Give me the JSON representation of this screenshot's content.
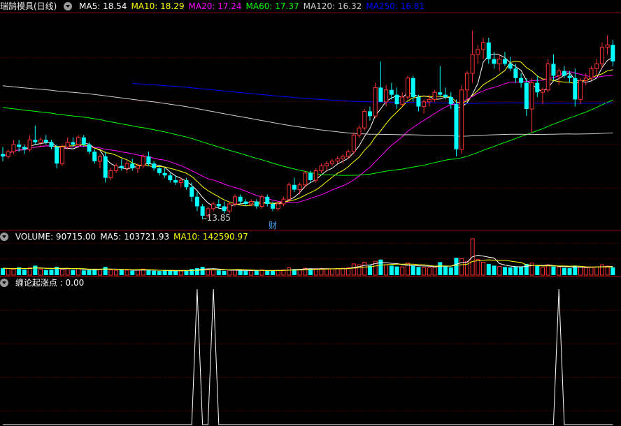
{
  "panels": {
    "price": {
      "title": "瑞鹄模具(日线)",
      "indicators": [
        {
          "label": "MA5: 18.54",
          "color": "#ffffff"
        },
        {
          "label": "MA10: 18.29",
          "color": "#ffff00"
        },
        {
          "label": "MA20: 17.24",
          "color": "#ff00ff"
        },
        {
          "label": "MA60: 17.37",
          "color": "#00ff00"
        },
        {
          "label": "MA120: 16.32",
          "color": "#d0d0d0"
        },
        {
          "label": "MA250: 16.81",
          "color": "#0000ff"
        }
      ],
      "low_marker": "13.85",
      "event_marker": "财"
    },
    "volume": {
      "indicators": [
        {
          "label": "VOLUME: 90715.00",
          "color": "#ffffff"
        },
        {
          "label": "MA5: 103721.93",
          "color": "#ffffff"
        },
        {
          "label": "MA10: 142590.97",
          "color": "#ffff00"
        }
      ]
    },
    "signal": {
      "indicators": [
        {
          "label": "缠论起涨点 : 0.00",
          "color": "#ffffff"
        }
      ]
    }
  },
  "colors": {
    "up": "#ff3232",
    "down": "#00ffff",
    "grid": "#7a0000"
  },
  "chart_data": [
    {
      "type": "candlestick",
      "title": "瑞鹄模具(日线)",
      "ylim": [
        13.5,
        22.5
      ],
      "candles": [
        [
          16.6,
          16.9,
          16.3,
          16.5
        ],
        [
          16.5,
          16.8,
          16.4,
          16.7
        ],
        [
          16.7,
          17.2,
          16.6,
          17.0
        ],
        [
          17.0,
          17.2,
          16.7,
          16.9
        ],
        [
          16.9,
          17.0,
          16.6,
          16.8
        ],
        [
          16.8,
          17.4,
          16.7,
          17.2
        ],
        [
          17.2,
          17.8,
          17.0,
          17.1
        ],
        [
          17.1,
          17.3,
          16.9,
          17.2
        ],
        [
          17.2,
          17.4,
          17.0,
          17.1
        ],
        [
          17.1,
          17.2,
          16.8,
          16.9
        ],
        [
          16.9,
          17.0,
          16.0,
          16.2
        ],
        [
          16.2,
          17.0,
          16.1,
          16.9
        ],
        [
          16.9,
          17.3,
          16.8,
          17.1
        ],
        [
          17.1,
          17.3,
          16.9,
          17.0
        ],
        [
          17.0,
          17.4,
          16.9,
          17.3
        ],
        [
          17.3,
          17.4,
          16.9,
          17.0
        ],
        [
          17.0,
          17.1,
          16.6,
          16.7
        ],
        [
          16.7,
          16.8,
          16.2,
          16.3
        ],
        [
          16.3,
          16.6,
          16.0,
          16.5
        ],
        [
          16.5,
          16.7,
          15.4,
          15.6
        ],
        [
          15.6,
          16.0,
          15.5,
          15.9
        ],
        [
          15.9,
          16.2,
          15.8,
          16.1
        ],
        [
          16.1,
          16.4,
          15.9,
          16.0
        ],
        [
          16.0,
          16.3,
          15.8,
          16.2
        ],
        [
          16.2,
          16.4,
          15.9,
          16.0
        ],
        [
          16.0,
          16.2,
          15.8,
          16.1
        ],
        [
          16.1,
          16.6,
          16.0,
          16.5
        ],
        [
          16.5,
          16.7,
          16.1,
          16.2
        ],
        [
          16.2,
          16.3,
          15.9,
          16.0
        ],
        [
          16.0,
          16.1,
          15.7,
          15.8
        ],
        [
          15.8,
          16.0,
          15.6,
          15.7
        ],
        [
          15.7,
          15.8,
          15.4,
          15.5
        ],
        [
          15.5,
          15.7,
          15.3,
          15.4
        ],
        [
          15.4,
          15.6,
          15.2,
          15.5
        ],
        [
          15.5,
          15.6,
          15.1,
          15.2
        ],
        [
          15.2,
          15.4,
          14.6,
          14.8
        ],
        [
          14.8,
          15.0,
          14.2,
          14.4
        ],
        [
          14.4,
          14.5,
          13.85,
          14.0
        ],
        [
          14.0,
          14.4,
          13.9,
          14.3
        ],
        [
          14.3,
          14.6,
          14.2,
          14.5
        ],
        [
          14.5,
          14.7,
          14.3,
          14.4
        ],
        [
          14.4,
          14.6,
          14.1,
          14.2
        ],
        [
          14.2,
          14.6,
          14.1,
          14.5
        ],
        [
          14.5,
          14.9,
          14.4,
          14.8
        ],
        [
          14.8,
          14.9,
          14.5,
          14.6
        ],
        [
          14.6,
          14.7,
          14.4,
          14.5
        ],
        [
          14.5,
          14.7,
          14.4,
          14.6
        ],
        [
          14.6,
          14.7,
          14.3,
          14.4
        ],
        [
          14.4,
          14.9,
          14.3,
          14.8
        ],
        [
          14.8,
          14.9,
          14.4,
          14.5
        ],
        [
          14.5,
          14.6,
          14.2,
          14.3
        ],
        [
          14.3,
          14.6,
          14.2,
          14.5
        ],
        [
          14.5,
          14.8,
          14.4,
          14.7
        ],
        [
          14.7,
          15.4,
          14.6,
          15.3
        ],
        [
          15.3,
          15.6,
          15.0,
          15.1
        ],
        [
          15.1,
          15.4,
          14.9,
          15.3
        ],
        [
          15.3,
          15.9,
          15.2,
          15.8
        ],
        [
          15.8,
          15.9,
          15.4,
          15.5
        ],
        [
          15.5,
          16.0,
          15.4,
          15.9
        ],
        [
          15.9,
          16.2,
          15.8,
          16.1
        ],
        [
          16.1,
          16.3,
          15.9,
          16.2
        ],
        [
          16.2,
          16.4,
          16.1,
          16.3
        ],
        [
          16.3,
          16.5,
          16.2,
          16.4
        ],
        [
          16.4,
          16.6,
          16.2,
          16.5
        ],
        [
          16.5,
          16.8,
          16.4,
          16.7
        ],
        [
          16.7,
          17.5,
          16.6,
          17.4
        ],
        [
          17.4,
          17.8,
          17.3,
          17.7
        ],
        [
          17.7,
          18.5,
          17.6,
          18.4
        ],
        [
          18.4,
          18.6,
          18.0,
          18.2
        ],
        [
          18.2,
          19.6,
          18.1,
          19.4
        ],
        [
          19.4,
          20.5,
          19.1,
          18.8
        ],
        [
          18.8,
          19.5,
          18.6,
          19.3
        ],
        [
          19.3,
          19.6,
          18.9,
          19.1
        ],
        [
          19.1,
          19.4,
          18.5,
          18.7
        ],
        [
          18.7,
          19.2,
          18.6,
          19.0
        ],
        [
          19.0,
          19.9,
          18.9,
          19.8
        ],
        [
          19.8,
          19.9,
          18.8,
          19.0
        ],
        [
          19.0,
          19.1,
          18.4,
          18.6
        ],
        [
          18.6,
          18.9,
          18.3,
          18.8
        ],
        [
          18.8,
          19.1,
          18.6,
          18.9
        ],
        [
          18.9,
          19.3,
          18.8,
          19.2
        ],
        [
          19.2,
          20.3,
          19.0,
          19.1
        ],
        [
          19.1,
          19.4,
          18.9,
          19.0
        ],
        [
          19.0,
          19.2,
          18.5,
          18.7
        ],
        [
          18.7,
          18.9,
          16.5,
          16.8
        ],
        [
          16.8,
          19.5,
          16.6,
          19.3
        ],
        [
          19.3,
          20.1,
          18.9,
          20.0
        ],
        [
          20.0,
          21.8,
          19.6,
          20.8
        ],
        [
          20.8,
          21.2,
          20.4,
          21.0
        ],
        [
          21.0,
          21.5,
          20.6,
          21.3
        ],
        [
          21.3,
          21.5,
          20.4,
          20.6
        ],
        [
          20.6,
          20.9,
          20.2,
          20.4
        ],
        [
          20.4,
          20.8,
          20.1,
          20.6
        ],
        [
          20.6,
          20.9,
          20.3,
          20.4
        ],
        [
          20.4,
          20.7,
          20.1,
          20.2
        ],
        [
          20.2,
          20.4,
          19.6,
          19.8
        ],
        [
          19.8,
          20.0,
          19.4,
          19.6
        ],
        [
          19.6,
          19.8,
          18.2,
          18.5
        ],
        [
          18.5,
          19.8,
          17.5,
          19.6
        ],
        [
          19.6,
          19.9,
          19.0,
          19.2
        ],
        [
          19.2,
          19.4,
          18.7,
          19.3
        ],
        [
          19.3,
          20.6,
          19.2,
          20.4
        ],
        [
          20.4,
          20.8,
          19.7,
          19.9
        ],
        [
          19.9,
          20.2,
          19.5,
          20.1
        ],
        [
          20.1,
          20.3,
          19.8,
          19.9
        ],
        [
          19.9,
          20.1,
          19.6,
          19.8
        ],
        [
          19.8,
          20.2,
          18.6,
          18.9
        ],
        [
          18.9,
          19.8,
          18.7,
          19.7
        ],
        [
          19.7,
          20.0,
          19.5,
          19.8
        ],
        [
          19.8,
          20.3,
          19.7,
          20.2
        ],
        [
          20.2,
          20.6,
          19.9,
          20.4
        ],
        [
          20.4,
          21.3,
          20.2,
          21.1
        ],
        [
          21.1,
          21.6,
          20.8,
          21.2
        ],
        [
          21.2,
          21.4,
          20.3,
          20.5
        ]
      ],
      "ma_periods": [
        5,
        10,
        20,
        60,
        120,
        250
      ],
      "ma_colors": [
        "#ffffff",
        "#ffff00",
        "#ff00ff",
        "#00ff00",
        "#d0d0d0",
        "#0000ff"
      ],
      "annotations": [
        {
          "text": "13.85"
        },
        {
          "text": "财"
        }
      ]
    },
    {
      "type": "bar",
      "title": "VOLUME",
      "ylim": [
        0,
        500000
      ],
      "values": [
        80000,
        75000,
        70000,
        90000,
        65000,
        85000,
        110000,
        70000,
        60000,
        65000,
        95000,
        70000,
        80000,
        60000,
        75000,
        55000,
        60000,
        70000,
        65000,
        95000,
        60000,
        55000,
        60000,
        58000,
        52000,
        60000,
        70000,
        55000,
        50000,
        48000,
        52000,
        55000,
        50000,
        48000,
        52000,
        70000,
        80000,
        95000,
        65000,
        60000,
        55000,
        50000,
        58000,
        62000,
        55000,
        50000,
        52000,
        54000,
        60000,
        50000,
        48000,
        55000,
        60000,
        85000,
        70000,
        65000,
        80000,
        70000,
        75000,
        78000,
        70000,
        72000,
        75000,
        80000,
        85000,
        130000,
        120000,
        150000,
        110000,
        160000,
        180000,
        120000,
        110000,
        100000,
        95000,
        140000,
        110000,
        95000,
        90000,
        85000,
        95000,
        150000,
        100000,
        90000,
        200000,
        190000,
        160000,
        420000,
        180000,
        150000,
        130000,
        110000,
        100000,
        95000,
        90000,
        100000,
        95000,
        130000,
        140000,
        105000,
        90000,
        120000,
        100000,
        95000,
        85000,
        80000,
        110000,
        95000,
        85000,
        90000,
        95000,
        120000,
        105000,
        90000
      ],
      "ma_lines": [
        {
          "name": "MA5",
          "color": "#ffffff"
        },
        {
          "name": "MA10",
          "color": "#ffff00"
        }
      ]
    },
    {
      "type": "line",
      "title": "缠论起涨点",
      "ylim": [
        0,
        1
      ],
      "peaks_at_index": [
        36,
        39,
        103
      ],
      "value_at_peak": 1,
      "value_elsewhere": 0
    }
  ]
}
